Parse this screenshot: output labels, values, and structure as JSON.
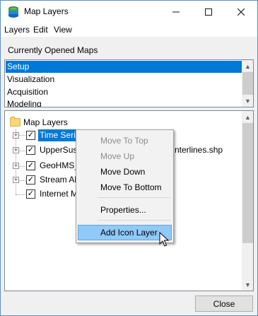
{
  "window": {
    "title": "Map Layers",
    "icon": "map-layers-app-icon",
    "controls": {
      "minimize": "minimize-icon",
      "maximize": "maximize-icon",
      "close": "close-icon"
    }
  },
  "menubar": {
    "items": [
      "Layers",
      "Edit",
      "View"
    ]
  },
  "currently_opened": {
    "label": "Currently Opened Maps",
    "maps": [
      "Setup",
      "Visualization",
      "Acquisition",
      "Modeling"
    ],
    "selected": "Setup"
  },
  "tree": {
    "root": "Map Layers",
    "layers": [
      {
        "label": "Time Seri",
        "checked": true,
        "expandable": true,
        "selected": true
      },
      {
        "label": "UpperSus",
        "trailing_label": "nterlines.shp",
        "checked": true,
        "expandable": true,
        "selected": false
      },
      {
        "label": "GeoHMS_",
        "checked": true,
        "expandable": true,
        "selected": false
      },
      {
        "label": "Stream Al",
        "checked": true,
        "expandable": true,
        "selected": false
      },
      {
        "label": "Internet M",
        "checked": true,
        "expandable": false,
        "selected": false
      }
    ]
  },
  "context_menu": {
    "items": [
      {
        "label": "Move To Top",
        "enabled": false
      },
      {
        "label": "Move Up",
        "enabled": false
      },
      {
        "label": "Move Down",
        "enabled": true
      },
      {
        "label": "Move To Bottom",
        "enabled": true
      },
      {
        "label": "Properties...",
        "enabled": true
      },
      {
        "label": "Add Icon Layer",
        "enabled": true,
        "hovered": true
      }
    ]
  },
  "footer": {
    "close_label": "Close"
  },
  "colors": {
    "selection": "#0078d7",
    "hover": "#91c9f7",
    "disabled_text": "#8c8c8c",
    "window_border": "#5a8fc5"
  }
}
